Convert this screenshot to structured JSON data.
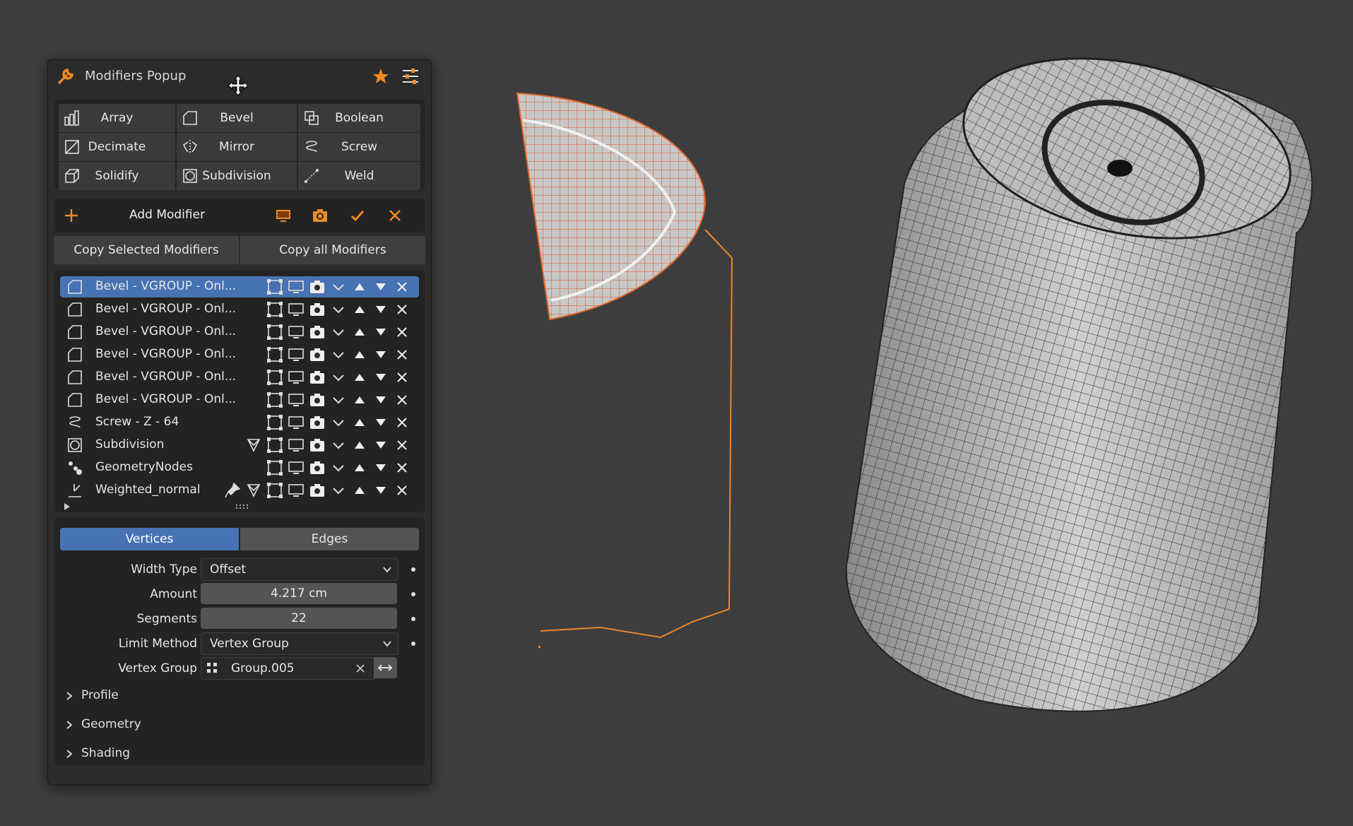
{
  "popup": {
    "title": "Modifiers Popup",
    "modifier_grid": [
      {
        "label": "Array",
        "icon": "array-icon"
      },
      {
        "label": "Bevel",
        "icon": "bevel-icon"
      },
      {
        "label": "Boolean",
        "icon": "boolean-icon"
      },
      {
        "label": "Decimate",
        "icon": "decimate-icon"
      },
      {
        "label": "Mirror",
        "icon": "mirror-icon"
      },
      {
        "label": "Screw",
        "icon": "screw-icon"
      },
      {
        "label": "Solidify",
        "icon": "solidify-icon"
      },
      {
        "label": "Subdivision",
        "icon": "subdivision-icon"
      },
      {
        "label": "Weld",
        "icon": "weld-icon"
      }
    ],
    "add_modifier_label": "Add Modifier",
    "copy_selected_label": "Copy Selected Modifiers",
    "copy_all_label": "Copy all Modifiers",
    "stack": [
      {
        "name": "Bevel - VGROUP - Onl...",
        "icon": "bevel-icon",
        "selected": true
      },
      {
        "name": "Bevel - VGROUP - Onl...",
        "icon": "bevel-icon"
      },
      {
        "name": "Bevel - VGROUP - Onl...",
        "icon": "bevel-icon"
      },
      {
        "name": "Bevel - VGROUP - Onl...",
        "icon": "bevel-icon"
      },
      {
        "name": "Bevel - VGROUP - Onl...",
        "icon": "bevel-icon"
      },
      {
        "name": "Bevel - VGROUP - Onl...",
        "icon": "bevel-icon"
      },
      {
        "name": "Screw - Z - 64",
        "icon": "screw-icon"
      },
      {
        "name": "Subdivision",
        "icon": "subdivision-icon"
      },
      {
        "name": "GeometryNodes",
        "icon": "geometry-nodes-icon"
      },
      {
        "name": "Weighted_normal",
        "icon": "weighted-normal-icon"
      }
    ],
    "tabs": {
      "vertices": "Vertices",
      "edges": "Edges",
      "active": "Vertices"
    },
    "props": {
      "width_type_label": "Width Type",
      "width_type_value": "Offset",
      "amount_label": "Amount",
      "amount_value": "4.217 cm",
      "segments_label": "Segments",
      "segments_value": "22",
      "limit_method_label": "Limit Method",
      "limit_method_value": "Vertex Group",
      "vertex_group_label": "Vertex Group",
      "vertex_group_value": "Group.005"
    },
    "sections": {
      "profile": "Profile",
      "geometry": "Geometry",
      "shading": "Shading"
    }
  },
  "colors": {
    "accent": "#f08a24",
    "selected": "#4772b3",
    "background": "#3d3d3d"
  }
}
